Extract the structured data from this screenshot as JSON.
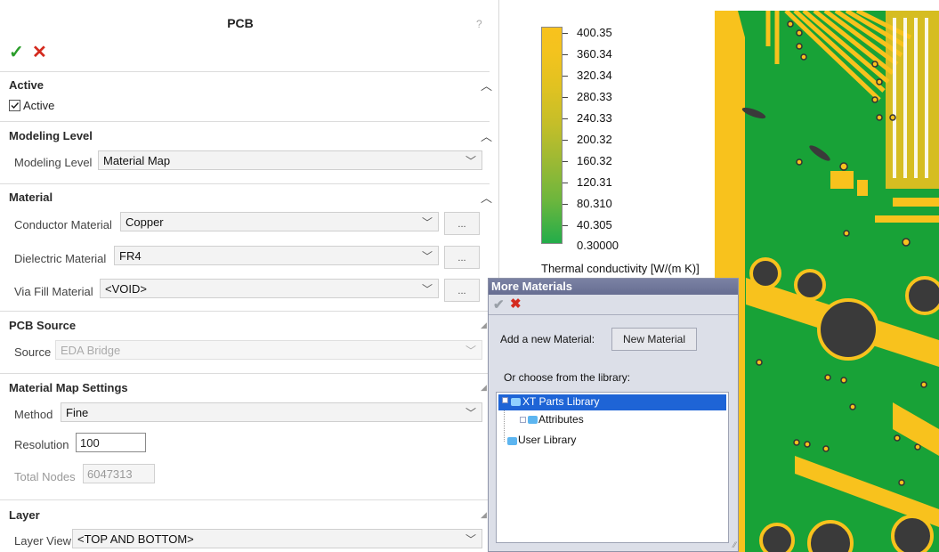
{
  "panel": {
    "title": "PCB",
    "help": "?",
    "ok": "✓",
    "cancel": "✕",
    "active": {
      "header": "Active",
      "checkbox_label": "Active",
      "checked": true
    },
    "modeling": {
      "header": "Modeling Level",
      "label": "Modeling Level",
      "value": "Material Map"
    },
    "material": {
      "header": "Material",
      "conductor_label": "Conductor Material",
      "conductor_value": "Copper",
      "dielectric_label": "Dielectric Material",
      "dielectric_value": "FR4",
      "viafill_label": "Via Fill Material",
      "viafill_value": "<VOID>",
      "browse": "..."
    },
    "source": {
      "header": "PCB Source",
      "label": "Source",
      "value": "EDA Bridge"
    },
    "mapsettings": {
      "header": "Material Map Settings",
      "method_label": "Method",
      "method_value": "Fine",
      "resolution_label": "Resolution",
      "resolution_value": "100",
      "nodes_label": "Total Nodes",
      "nodes_value": "6047313"
    },
    "layer": {
      "header": "Layer",
      "view_label": "Layer View",
      "view_value": "<TOP AND BOTTOM>"
    }
  },
  "legend": {
    "values": [
      "400.35",
      "360.34",
      "320.34",
      "280.33",
      "240.33",
      "200.32",
      "160.32",
      "120.31",
      "80.310",
      "40.305",
      "0.30000"
    ],
    "title": "Thermal conductivity [W/(m K)]",
    "colors": {
      "top": "#f8c21d",
      "bottom": "#23ad4a"
    }
  },
  "dialog": {
    "title": "More Materials",
    "add_label": "Add a new Material:",
    "new_button": "New Material",
    "library_label": "Or choose from the library:",
    "tree": [
      {
        "label": "XT Parts Library",
        "selected": true
      },
      {
        "label": "Attributes",
        "selected": false
      },
      {
        "label": "User Library",
        "selected": false
      }
    ]
  },
  "colors": {
    "pcb_green": "#18a237",
    "pcb_copper": "#f8c21d",
    "pad_hole": "#3a3a3a"
  }
}
